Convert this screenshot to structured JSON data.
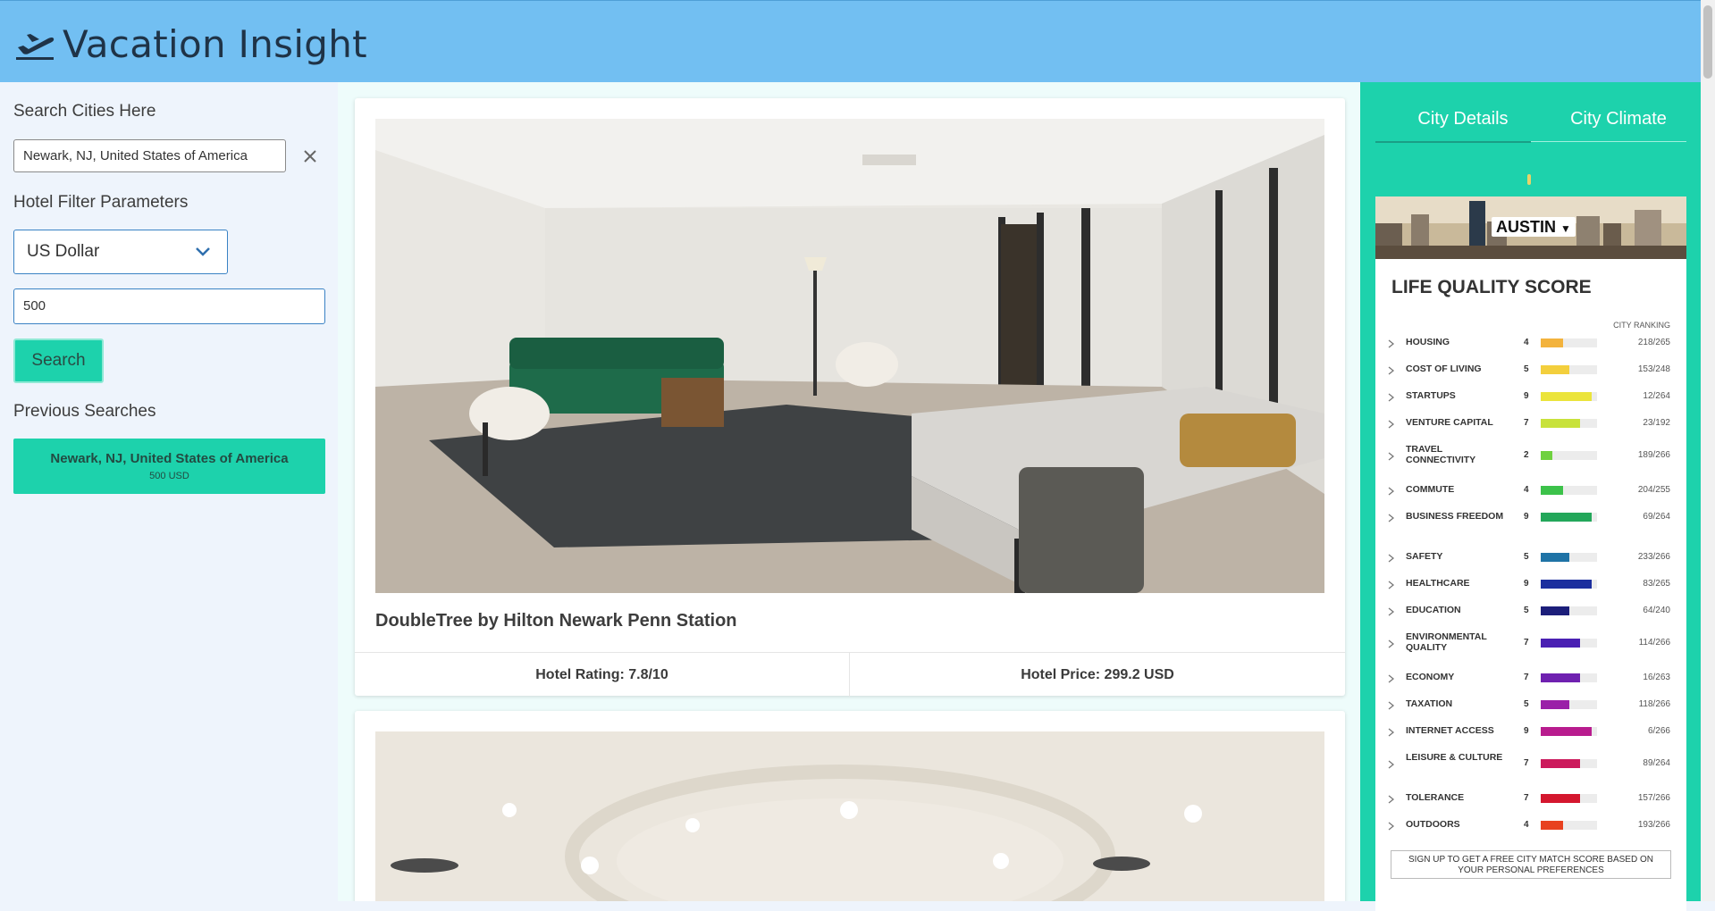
{
  "header": {
    "title": "Vacation Insight",
    "logo_icon": "airplane-departure-icon"
  },
  "sidebar": {
    "search_label": "Search Cities Here",
    "city_value": "Newark, NJ, United States of America",
    "filter_label": "Hotel Filter Parameters",
    "currency": "US Dollar",
    "price_value": "500",
    "search_button": "Search",
    "previous_label": "Previous Searches",
    "previous": [
      {
        "city": "Newark, NJ, United States of America",
        "amount": "500 USD"
      }
    ]
  },
  "hotels": [
    {
      "name": "DoubleTree by Hilton Newark Penn Station",
      "rating": "Hotel Rating: 7.8/10",
      "price": "Hotel Price: 299.2 USD"
    }
  ],
  "right_panel": {
    "tabs": [
      "City Details",
      "City Climate"
    ],
    "widget": {
      "city": "AUSTIN",
      "title": "LIFE QUALITY SCORE",
      "ranking_header": "CITY RANKING",
      "categories": [
        {
          "name": "HOUSING",
          "score": 4,
          "rank": "218/265",
          "color": "#f3b33d"
        },
        {
          "name": "COST OF LIVING",
          "score": 5,
          "rank": "153/248",
          "color": "#f3cf3d"
        },
        {
          "name": "STARTUPS",
          "score": 9,
          "rank": "12/264",
          "color": "#ebe43b"
        },
        {
          "name": "VENTURE CAPITAL",
          "score": 7,
          "rank": "23/192",
          "color": "#c8e23b"
        },
        {
          "name": "TRAVEL CONNECTIVITY",
          "score": 2,
          "rank": "189/266",
          "color": "#6fd13f"
        },
        {
          "name": "COMMUTE",
          "score": 4,
          "rank": "204/255",
          "color": "#3cc24a"
        },
        {
          "name": "BUSINESS FREEDOM",
          "score": 9,
          "rank": "69/264",
          "color": "#23a75a"
        },
        {
          "name": "SAFETY",
          "score": 5,
          "rank": "233/266",
          "color": "#1f73a6"
        },
        {
          "name": "HEALTHCARE",
          "score": 9,
          "rank": "83/265",
          "color": "#1c2f9e"
        },
        {
          "name": "EDUCATION",
          "score": 5,
          "rank": "64/240",
          "color": "#1c1e7a"
        },
        {
          "name": "ENVIRONMENTAL QUALITY",
          "score": 7,
          "rank": "114/266",
          "color": "#4a20b3"
        },
        {
          "name": "ECONOMY",
          "score": 7,
          "rank": "16/263",
          "color": "#6f21b0"
        },
        {
          "name": "TAXATION",
          "score": 5,
          "rank": "118/266",
          "color": "#9a1fa8"
        },
        {
          "name": "INTERNET ACCESS",
          "score": 9,
          "rank": "6/266",
          "color": "#b81c8e"
        },
        {
          "name": "LEISURE & CULTURE",
          "score": 7,
          "rank": "89/264",
          "color": "#cc1a5c"
        },
        {
          "name": "TOLERANCE",
          "score": 7,
          "rank": "157/266",
          "color": "#d4172e"
        },
        {
          "name": "OUTDOORS",
          "score": 4,
          "rank": "193/266",
          "color": "#e8411f"
        }
      ],
      "signup_text": "SIGN UP TO GET A FREE CITY MATCH SCORE BASED ON YOUR PERSONAL PREFERENCES"
    }
  },
  "colors": {
    "header": "#72bff2",
    "accent": "#1dd2ac",
    "sidebar": "#eef4fc"
  }
}
